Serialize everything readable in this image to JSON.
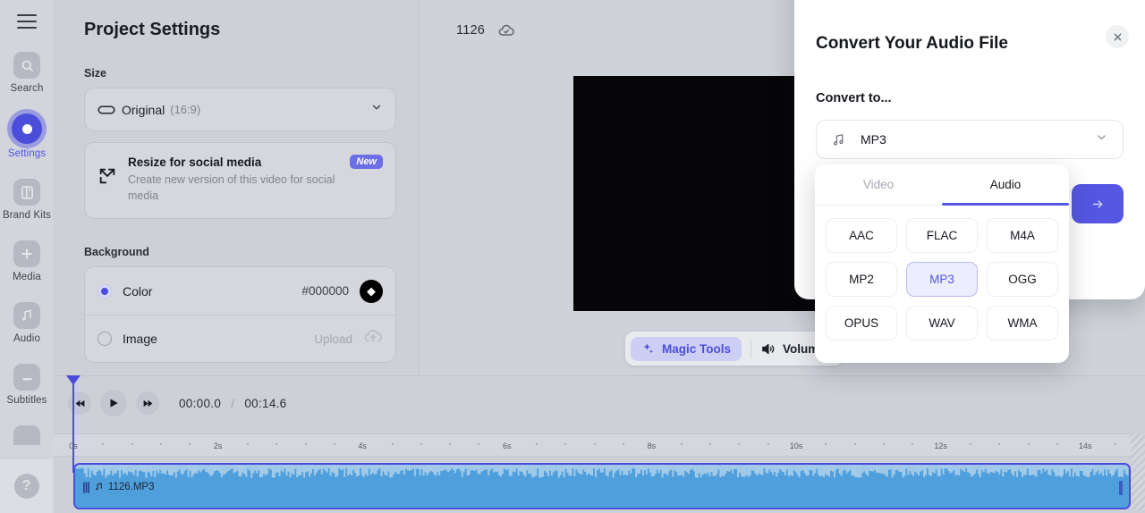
{
  "rail": {
    "menu_icon": "hamburger-icon",
    "items": [
      {
        "label": "Search",
        "icon": "search-icon",
        "active": false
      },
      {
        "label": "Settings",
        "icon": "settings-record-icon",
        "active": true
      },
      {
        "label": "Brand Kits",
        "icon": "brand-kits-icon",
        "active": false
      },
      {
        "label": "Media",
        "icon": "plus-media-icon",
        "active": false
      },
      {
        "label": "Audio",
        "icon": "music-note-icon",
        "active": false
      },
      {
        "label": "Subtitles",
        "icon": "subtitles-icon",
        "active": false
      }
    ],
    "help_label": "?"
  },
  "panel": {
    "title": "Project Settings",
    "size": {
      "section_label": "Size",
      "value": "Original",
      "ratio": "(16:9)",
      "icon": "rounded-rect-icon",
      "chevron": "chevron-down-icon"
    },
    "resize": {
      "heading": "Resize for social media",
      "subtext": "Create new version of this video for social media",
      "badge": "New",
      "icon": "resize-expand-icon"
    },
    "background": {
      "section_label": "Background",
      "color_label": "Color",
      "color_value": "#000000",
      "color_selected": true,
      "swatch_icon": "paint-bucket-icon",
      "image_label": "Image",
      "image_action": "Upload",
      "image_selected": false,
      "upload_icon": "cloud-upload-icon"
    }
  },
  "stage": {
    "project_name": "1126",
    "cloud_icon": "cloud-saved-icon",
    "toolbar": {
      "magic_tools_label": "Magic Tools",
      "magic_icon": "sparkles-icon",
      "volume_label": "Volume",
      "volume_icon": "speaker-icon"
    }
  },
  "timeline": {
    "controls": {
      "rewind_icon": "rewind-icon",
      "play_icon": "play-icon",
      "forward_icon": "fast-forward-icon"
    },
    "current_time": "00:00.0",
    "separator": "/",
    "total_time": "00:14.6",
    "ruler_ticks": [
      "0s",
      "2s",
      "4s",
      "6s",
      "8s",
      "10s",
      "12s",
      "14s"
    ],
    "clip": {
      "name": "1126.MP3",
      "handle_icon": "drag-handle-icon",
      "music_icon": "music-note-icon"
    }
  },
  "modal": {
    "title": "Convert Your Audio File",
    "close_icon": "close-icon",
    "subtitle": "Convert to...",
    "select": {
      "value": "MP3",
      "icon": "music-note-icon",
      "chevron": "chevron-down-icon"
    },
    "submit_icon": "arrow-right-icon",
    "dropdown": {
      "tabs": [
        {
          "label": "Video",
          "active": false
        },
        {
          "label": "Audio",
          "active": true
        }
      ],
      "formats": [
        "AAC",
        "FLAC",
        "M4A",
        "MP2",
        "MP3",
        "OGG",
        "OPUS",
        "WAV",
        "WMA"
      ],
      "selected_format": "MP3"
    }
  },
  "colors": {
    "accent": "#5557e2",
    "accent_light": "#6b6ee4",
    "app_bg": "#cfd2d9",
    "clip": "#4f9fdd"
  }
}
